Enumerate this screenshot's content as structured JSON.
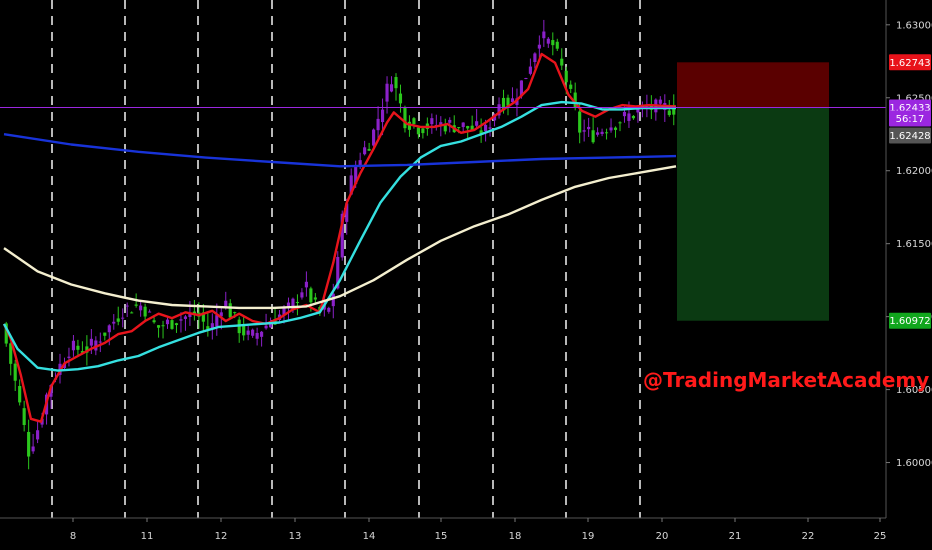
{
  "chart_data": {
    "type": "candlestick",
    "watermark": "@TradingMarketAcademy",
    "y_axis": {
      "ticks": [
        "1.63000",
        "1.62500",
        "1.62000",
        "1.61500",
        "1.61000",
        "1.60500",
        "1.60000"
      ],
      "tick_values": [
        1.63,
        1.625,
        1.62,
        1.615,
        1.61,
        1.605,
        1.6
      ],
      "ylim": [
        1.5962,
        1.6317
      ]
    },
    "x_axis": {
      "ticks": [
        "8",
        "11",
        "12",
        "13",
        "14",
        "15",
        "18",
        "19",
        "20",
        "21",
        "22",
        "25"
      ],
      "session_separators": true
    },
    "price_tags": [
      {
        "id": "stop",
        "label": "1.62743",
        "value": 1.62743,
        "color": "#e8121a",
        "text_color": "#ffffff"
      },
      {
        "id": "current",
        "label": "1.62433",
        "value": 1.62433,
        "color": "#9b27e0",
        "text_color": "#ffffff"
      },
      {
        "id": "countdown",
        "label": "56:17",
        "color": "#9b27e0",
        "text_color": "#ffffff"
      },
      {
        "id": "last",
        "label": "1.62428",
        "value": 1.62428,
        "color": "#555555",
        "text_color": "#ffffff"
      },
      {
        "id": "target",
        "label": "1.60972",
        "value": 1.60972,
        "color": "#11a61d",
        "text_color": "#ffffff"
      }
    ],
    "position": {
      "entry": 1.62433,
      "stop": 1.62743,
      "target": 1.60972,
      "risk_color": "#5a0000",
      "reward_color": "#0b3a12"
    },
    "moving_averages": [
      {
        "color": "#e8141c",
        "points": [
          [
            0.0,
            1.6095
          ],
          [
            0.01,
            1.6085
          ],
          [
            0.025,
            1.606
          ],
          [
            0.04,
            1.603
          ],
          [
            0.055,
            1.6028
          ],
          [
            0.07,
            1.6052
          ],
          [
            0.09,
            1.6068
          ],
          [
            0.11,
            1.6073
          ],
          [
            0.13,
            1.6078
          ],
          [
            0.15,
            1.6082
          ],
          [
            0.17,
            1.6088
          ],
          [
            0.19,
            1.609
          ],
          [
            0.21,
            1.6097
          ],
          [
            0.23,
            1.6102
          ],
          [
            0.25,
            1.6099
          ],
          [
            0.27,
            1.6103
          ],
          [
            0.29,
            1.6101
          ],
          [
            0.31,
            1.6104
          ],
          [
            0.33,
            1.6097
          ],
          [
            0.35,
            1.6102
          ],
          [
            0.37,
            1.6097
          ],
          [
            0.39,
            1.6095
          ],
          [
            0.41,
            1.6099
          ],
          [
            0.43,
            1.6105
          ],
          [
            0.45,
            1.6108
          ],
          [
            0.47,
            1.6103
          ],
          [
            0.49,
            1.6137
          ],
          [
            0.51,
            1.6178
          ],
          [
            0.53,
            1.6198
          ],
          [
            0.55,
            1.6215
          ],
          [
            0.57,
            1.6233
          ],
          [
            0.58,
            1.624
          ],
          [
            0.6,
            1.6232
          ],
          [
            0.62,
            1.623
          ],
          [
            0.64,
            1.623
          ],
          [
            0.66,
            1.6232
          ],
          [
            0.68,
            1.6226
          ],
          [
            0.7,
            1.6228
          ],
          [
            0.72,
            1.6234
          ],
          [
            0.74,
            1.6241
          ],
          [
            0.76,
            1.6247
          ],
          [
            0.78,
            1.6256
          ],
          [
            0.8,
            1.628
          ],
          [
            0.82,
            1.6274
          ],
          [
            0.84,
            1.6252
          ],
          [
            0.86,
            1.6241
          ],
          [
            0.88,
            1.6237
          ],
          [
            0.9,
            1.6242
          ],
          [
            0.92,
            1.6245
          ],
          [
            0.94,
            1.6244
          ],
          [
            0.96,
            1.6245
          ],
          [
            1.0,
            1.6244
          ]
        ]
      },
      {
        "color": "#35e0e0",
        "points": [
          [
            0.0,
            1.6095
          ],
          [
            0.02,
            1.6078
          ],
          [
            0.05,
            1.6065
          ],
          [
            0.08,
            1.6063
          ],
          [
            0.11,
            1.6064
          ],
          [
            0.14,
            1.6066
          ],
          [
            0.17,
            1.607
          ],
          [
            0.2,
            1.6073
          ],
          [
            0.23,
            1.6079
          ],
          [
            0.26,
            1.6084
          ],
          [
            0.29,
            1.6089
          ],
          [
            0.32,
            1.6093
          ],
          [
            0.35,
            1.6094
          ],
          [
            0.38,
            1.6095
          ],
          [
            0.41,
            1.6096
          ],
          [
            0.44,
            1.6099
          ],
          [
            0.47,
            1.6103
          ],
          [
            0.5,
            1.6125
          ],
          [
            0.53,
            1.6152
          ],
          [
            0.56,
            1.6178
          ],
          [
            0.59,
            1.6196
          ],
          [
            0.62,
            1.6209
          ],
          [
            0.65,
            1.6217
          ],
          [
            0.68,
            1.622
          ],
          [
            0.71,
            1.6225
          ],
          [
            0.74,
            1.623
          ],
          [
            0.77,
            1.6237
          ],
          [
            0.8,
            1.6245
          ],
          [
            0.83,
            1.6247
          ],
          [
            0.86,
            1.6246
          ],
          [
            0.89,
            1.6242
          ],
          [
            0.92,
            1.6242
          ],
          [
            0.95,
            1.6243
          ],
          [
            1.0,
            1.6243
          ]
        ]
      },
      {
        "color": "#1833d9",
        "points": [
          [
            0.0,
            1.6225
          ],
          [
            0.1,
            1.6218
          ],
          [
            0.2,
            1.6213
          ],
          [
            0.3,
            1.6209
          ],
          [
            0.4,
            1.6206
          ],
          [
            0.5,
            1.6203
          ],
          [
            0.6,
            1.6204
          ],
          [
            0.7,
            1.6206
          ],
          [
            0.8,
            1.6208
          ],
          [
            0.9,
            1.6209
          ],
          [
            1.0,
            1.621
          ]
        ]
      },
      {
        "color": "#f4efcf",
        "points": [
          [
            0.0,
            1.6147
          ],
          [
            0.05,
            1.6131
          ],
          [
            0.1,
            1.6122
          ],
          [
            0.15,
            1.6116
          ],
          [
            0.2,
            1.6111
          ],
          [
            0.25,
            1.6108
          ],
          [
            0.3,
            1.6107
          ],
          [
            0.35,
            1.6106
          ],
          [
            0.4,
            1.6106
          ],
          [
            0.45,
            1.6107
          ],
          [
            0.5,
            1.6114
          ],
          [
            0.55,
            1.6125
          ],
          [
            0.6,
            1.6139
          ],
          [
            0.65,
            1.6152
          ],
          [
            0.7,
            1.6162
          ],
          [
            0.75,
            1.617
          ],
          [
            0.8,
            1.618
          ],
          [
            0.85,
            1.6189
          ],
          [
            0.9,
            1.6195
          ],
          [
            0.95,
            1.6199
          ],
          [
            1.0,
            1.6203
          ]
        ]
      }
    ],
    "candle_series": {
      "count": 150,
      "up_color": "#8b21c9",
      "down_color": "#2bc71d",
      "anchors": [
        [
          0.0,
          1.6095
        ],
        [
          0.02,
          1.6055
        ],
        [
          0.04,
          1.6008
        ],
        [
          0.055,
          1.6025
        ],
        [
          0.07,
          1.6052
        ],
        [
          0.1,
          1.6078
        ],
        [
          0.13,
          1.6078
        ],
        [
          0.16,
          1.6093
        ],
        [
          0.18,
          1.6105
        ],
        [
          0.21,
          1.6108
        ],
        [
          0.23,
          1.6092
        ],
        [
          0.26,
          1.6098
        ],
        [
          0.29,
          1.6102
        ],
        [
          0.31,
          1.609
        ],
        [
          0.33,
          1.6112
        ],
        [
          0.35,
          1.6094
        ],
        [
          0.37,
          1.6085
        ],
        [
          0.4,
          1.6097
        ],
        [
          0.43,
          1.6106
        ],
        [
          0.45,
          1.6122
        ],
        [
          0.47,
          1.6103
        ],
        [
          0.49,
          1.6105
        ],
        [
          0.51,
          1.6178
        ],
        [
          0.53,
          1.6208
        ],
        [
          0.55,
          1.6222
        ],
        [
          0.58,
          1.6265
        ],
        [
          0.6,
          1.6235
        ],
        [
          0.62,
          1.623
        ],
        [
          0.65,
          1.6232
        ],
        [
          0.68,
          1.6231
        ],
        [
          0.72,
          1.6227
        ],
        [
          0.74,
          1.6247
        ],
        [
          0.76,
          1.6248
        ],
        [
          0.78,
          1.6266
        ],
        [
          0.8,
          1.6292
        ],
        [
          0.82,
          1.6286
        ],
        [
          0.84,
          1.6262
        ],
        [
          0.86,
          1.6228
        ],
        [
          0.88,
          1.6225
        ],
        [
          0.9,
          1.623
        ],
        [
          0.93,
          1.6237
        ],
        [
          0.96,
          1.6243
        ],
        [
          1.0,
          1.6243
        ]
      ]
    }
  }
}
